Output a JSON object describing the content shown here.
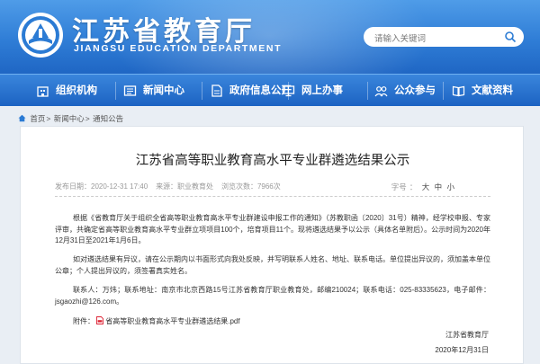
{
  "header": {
    "title": "江苏省教育厅",
    "subtitle": "JIANGSU EDUCATION DEPARTMENT",
    "search_placeholder": "请输入关键词"
  },
  "nav": [
    {
      "label": "组织机构",
      "icon": "building-icon"
    },
    {
      "label": "新闻中心",
      "icon": "news-icon"
    },
    {
      "label": "政府信息公开",
      "icon": "document-icon"
    },
    {
      "label": "网上办事",
      "icon": "monitor-icon"
    },
    {
      "label": "公众参与",
      "icon": "people-icon"
    },
    {
      "label": "文献资料",
      "icon": "book-icon"
    }
  ],
  "breadcrumb": [
    "首页",
    "新闻中心",
    "通知公告"
  ],
  "article": {
    "title": "江苏省高等职业教育高水平专业群遴选结果公示",
    "meta_date": "发布日期：2020-12-31 17:40",
    "meta_source": "来源：职业教育处",
    "meta_views": "浏览次数：7966次",
    "font_size_label": "字号",
    "font_sizes": [
      "大",
      "中",
      "小"
    ],
    "paragraphs": [
      "根据《省教育厅关于组织全省高等职业教育高水平专业群建设申报工作的通知》（苏教职函〔2020〕31号）精神，经学校申报、专家评审，共确定省高等职业教育高水平专业群立项项目100个，培育项目11个。现将遴选结果予以公示（具体名单附后）。公示时间为2020年12月31日至2021年1月6日。",
      "如对遴选结果有异议，请在公示期内以书面形式向我处反映，并写明联系人姓名、地址、联系电话。单位提出异议的，须加盖本单位公章；个人提出异议的，须签署真实姓名。",
      "联系人：万炜；联系地址：南京市北京西路15号江苏省教育厅职业教育处，邮编210024；联系电话：025-83335623，电子邮件：jsgaozhi@126.com。"
    ],
    "attachment_label": "附件：",
    "attachment_name": "省高等职业教育高水平专业群遴选结果.pdf",
    "signature_org": "江苏省教育厅",
    "signature_date": "2020年12月31日"
  }
}
